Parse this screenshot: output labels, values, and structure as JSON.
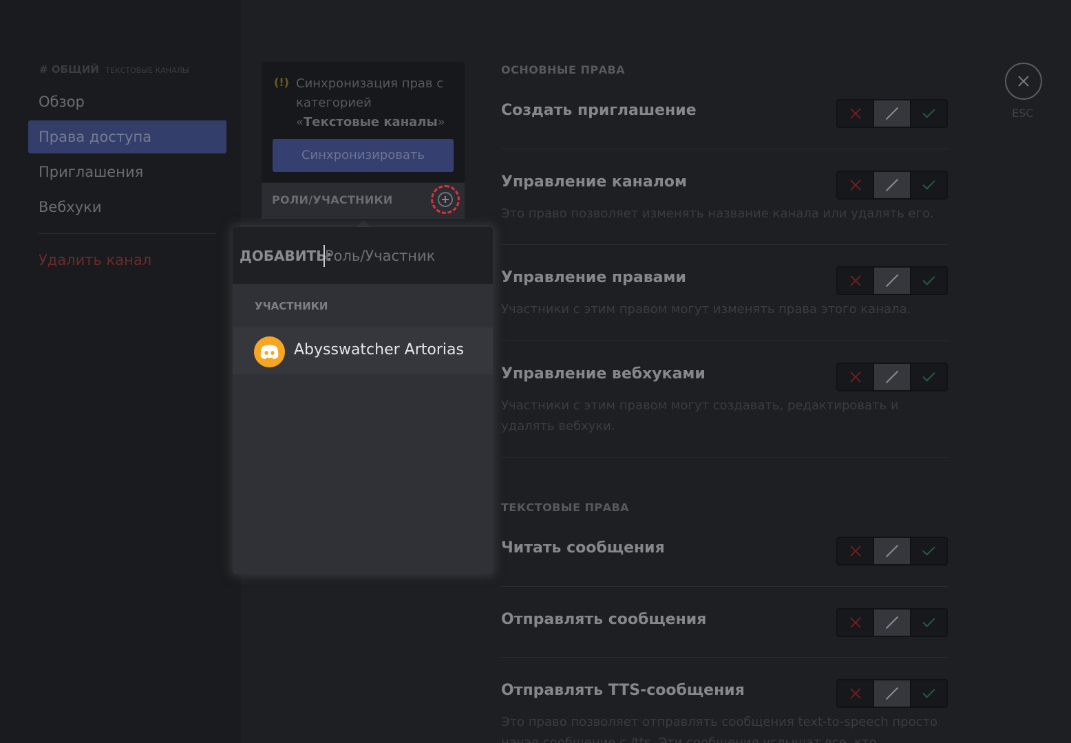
{
  "sidebar": {
    "header_hash": "#",
    "header_channel": "ОБЩИЙ",
    "header_category": "ТЕКСТОВЫЕ КАНАЛЫ",
    "items": [
      {
        "label": "Обзор"
      },
      {
        "label": "Права доступа"
      },
      {
        "label": "Приглашения"
      },
      {
        "label": "Вебхуки"
      }
    ],
    "delete_label": "Удалить канал"
  },
  "sync": {
    "text_prefix": "Синхронизация прав с категорией «",
    "category": "Текстовые каналы",
    "text_suffix": "»",
    "button": "Синхронизировать"
  },
  "roles": {
    "title": "РОЛИ/УЧАСТНИКИ"
  },
  "popup": {
    "add_label": "ДОБАВИТЬ:",
    "placeholder": "Роль/Участник",
    "section": "УЧАСТНИКИ",
    "members": [
      {
        "name": "Abysswatcher Artorias"
      }
    ]
  },
  "close": {
    "esc": "ESC"
  },
  "permissions": {
    "general_title": "ОСНОВНЫЕ ПРАВА",
    "general": [
      {
        "name": "Создать приглашение",
        "desc": ""
      },
      {
        "name": "Управление каналом",
        "desc": "Это право позволяет изменять название канала или удалять его."
      },
      {
        "name": "Управление правами",
        "desc": "Участники с этим правом могут изменять права этого канала."
      },
      {
        "name": "Управление вебхуками",
        "desc": "Участники с этим правом могут создавать, редактировать и удалять вебхуки."
      }
    ],
    "text_title": "ТЕКСТОВЫЕ ПРАВА",
    "text": [
      {
        "name": "Читать сообщения",
        "desc": ""
      },
      {
        "name": "Отправлять сообщения",
        "desc": ""
      },
      {
        "name": "Отправлять TTS-сообщения",
        "desc": "Это право позволяет отправлять сообщения text-to-speech просто начав сообщение с /tts. Эти сообщения услышат все, кто находится"
      }
    ]
  },
  "colors": {
    "accent": "#343e6a",
    "danger": "#e0323a",
    "avatar": "#f6a623"
  }
}
